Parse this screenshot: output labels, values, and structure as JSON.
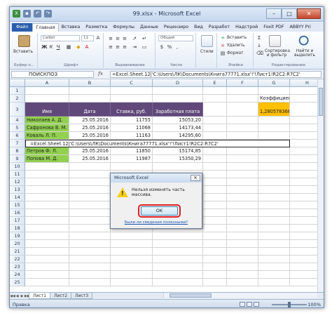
{
  "window": {
    "title": "99.xlsx - Microsoft Excel"
  },
  "tabs": [
    "Файл",
    "Главная",
    "Вставка",
    "Разметка",
    "Формулы",
    "Данные",
    "Рецензиро",
    "Вид",
    "Разработ",
    "Надстрой",
    "Foxit PDF",
    "ABBYY Pri"
  ],
  "ribbon": {
    "paste_label": "Вставить",
    "clipboard": "Буфер о...",
    "font_name": "Calibri",
    "font_size": "11",
    "font_group": "Шрифт",
    "align_group": "Выравнивание",
    "number_format": "Общий",
    "number_group": "Число",
    "styles_label": "Стили",
    "insert_label": "Вставить",
    "delete_label": "Удалить",
    "format_label": "Формат",
    "cells_group": "Ячейки",
    "sort_label": "Сортировка и фильтр",
    "find_label": "Найти и выделить",
    "edit_group": "Редактирование"
  },
  "formula_bar": {
    "name_box": "ПОИСКПОЗ",
    "fx": "fx",
    "formula": "=Excel.Sheet.12|'C:\\Users\\ЛК\\Documents\\Книга77771.xlsx'!'!Лист1!R2C2:R7C2'"
  },
  "columns": [
    "A",
    "B",
    "C",
    "D",
    "E",
    "F",
    "G",
    "H"
  ],
  "rows": [
    "1",
    "2",
    "3",
    "4",
    "5",
    "6",
    "7",
    "8",
    "9",
    "10",
    "11",
    "12",
    "13",
    "14",
    "15",
    "16",
    "17",
    "18",
    "19",
    "20",
    "21",
    "22",
    "23",
    "24",
    "25"
  ],
  "sheet": {
    "headers": [
      "Имя",
      "Дата",
      "Ставка, руб.",
      "Заработная плата"
    ],
    "rows": [
      [
        "Николаев А. Д.",
        "25.05.2016",
        "11755",
        "15053,20"
      ],
      [
        "Сафронова В. М.",
        "25.05.2016",
        "11068",
        "14173,44"
      ],
      [
        "Коваль Л. П.",
        "25.05.2016",
        "11163",
        "14295,60"
      ],
      [
        "Петров Ф. Л.",
        "25.05.2016",
        "11850",
        "15174,85"
      ],
      [
        "Попова М. Д.",
        "25.05.2016",
        "11987",
        "15350,29"
      ]
    ],
    "row7_formula": "=Excel.Sheet.12|'C:\\Users\\ЛК\\Documents\\Книга77771.xlsx'!'!Лист1!R2C2:R7C2'",
    "coef_label": "Коэффициент",
    "coef_value": "1,280578366"
  },
  "sheet_tabs": [
    "Лист1",
    "Лист2",
    "Лист3"
  ],
  "status": {
    "mode": "Правка",
    "zoom": "100%",
    "zoom_level": 100
  },
  "dialog": {
    "title": "Microsoft Excel",
    "message": "Нельзя изменять часть массива.",
    "ok": "OK",
    "help": "Были ли сведения полезными?"
  }
}
